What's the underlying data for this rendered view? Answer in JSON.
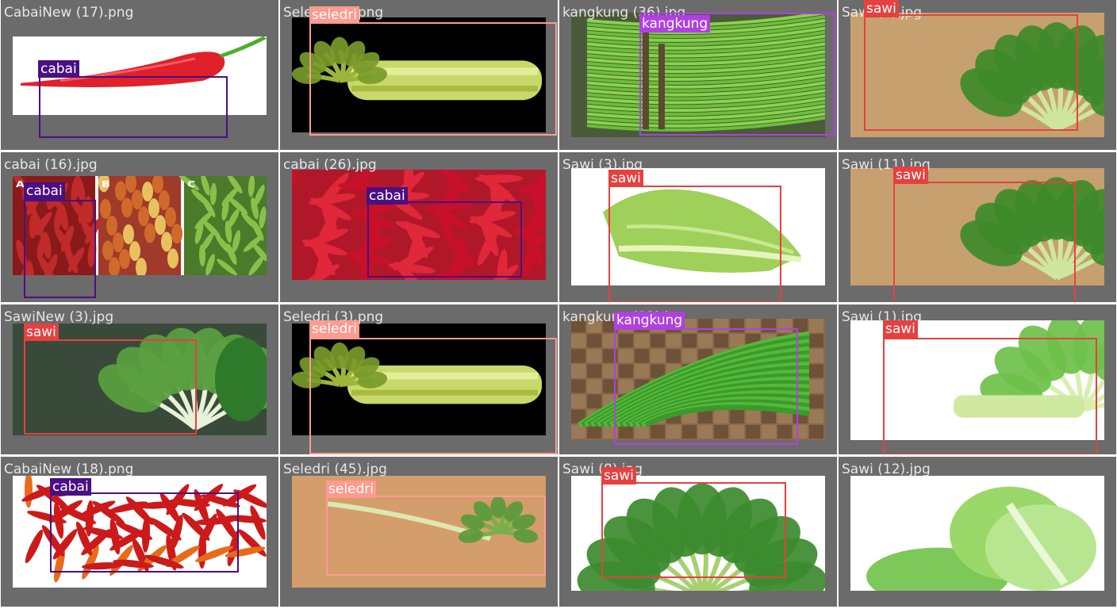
{
  "classes": {
    "cabai": {
      "color": "#4b0f84"
    },
    "seledri": {
      "color": "#ff9a8f"
    },
    "kangkung": {
      "color": "#b040e0"
    },
    "sawi": {
      "color": "#e64040"
    }
  },
  "tiles": [
    {
      "filename": "CabaiNew (17).png",
      "scene": "chili-single",
      "detections": [
        {
          "label": "cabai"
        }
      ]
    },
    {
      "filename": "Seledri (2).png",
      "scene": "celery-black",
      "detections": [
        {
          "label": "seledri"
        }
      ]
    },
    {
      "filename": "kangkung (36).jpg",
      "scene": "kangkung-bunch",
      "detections": [
        {
          "label": "kangkung"
        }
      ]
    },
    {
      "filename": "Sawi (4).jpg",
      "scene": "bokchoy-paper",
      "detections": [
        {
          "label": "sawi"
        }
      ]
    },
    {
      "filename": "cabai (16).jpg",
      "scene": "chili-triple",
      "detections": [
        {
          "label": "cabai"
        }
      ]
    },
    {
      "filename": "cabai (26).jpg",
      "scene": "chili-pile-red",
      "detections": [
        {
          "label": "cabai"
        }
      ]
    },
    {
      "filename": "Sawi (3).jpg",
      "scene": "sawi-white",
      "detections": [
        {
          "label": "sawi"
        }
      ]
    },
    {
      "filename": "Sawi (11).jpg",
      "scene": "bokchoy-paper",
      "detections": [
        {
          "label": "sawi"
        }
      ]
    },
    {
      "filename": "SawiNew (3).jpg",
      "scene": "bokchoy-dark",
      "detections": [
        {
          "label": "sawi"
        }
      ]
    },
    {
      "filename": "Seledri (3).png",
      "scene": "celery-black",
      "detections": [
        {
          "label": "seledri"
        }
      ]
    },
    {
      "filename": "kangkung (23).jpg",
      "scene": "kangkung-weave",
      "detections": [
        {
          "label": "kangkung"
        }
      ]
    },
    {
      "filename": "Sawi (1).jpg",
      "scene": "bokchoy-white",
      "detections": [
        {
          "label": "sawi"
        }
      ]
    },
    {
      "filename": "CabaiNew (18).png",
      "scene": "chili-heap",
      "detections": [
        {
          "label": "cabai"
        }
      ]
    },
    {
      "filename": "Seledri (45).jpg",
      "scene": "celery-board",
      "detections": [
        {
          "label": "seledri"
        }
      ]
    },
    {
      "filename": "Sawi (8).jpg",
      "scene": "greens-white",
      "detections": [
        {
          "label": "sawi"
        }
      ]
    },
    {
      "filename": "Sawi (12).jpg",
      "scene": "cabbage-white",
      "detections": []
    }
  ]
}
